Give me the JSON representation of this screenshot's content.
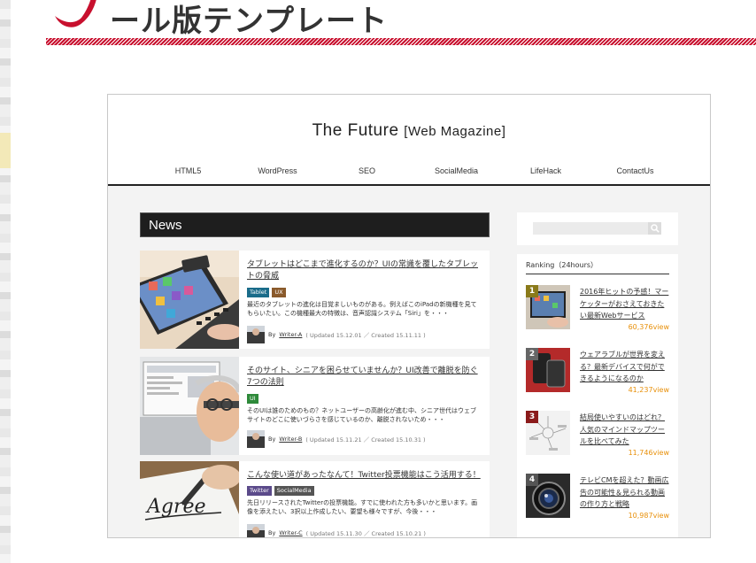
{
  "page": {
    "heading": "ール版テンプレート"
  },
  "site": {
    "title": "The Future",
    "subtitle": "[Web Magazine]",
    "nav": [
      "HTML5",
      "WordPress",
      "SEO",
      "SocialMedia",
      "LifeHack",
      "ContactUs"
    ]
  },
  "news": {
    "section_title": "News",
    "articles": [
      {
        "title": "タブレットはどこまで進化するのか？UIの常識を覆したタブレットの脅威",
        "tags": [
          {
            "label": "Tablet",
            "color": "#1a6c8a"
          },
          {
            "label": "UX",
            "color": "#8a5a2b"
          }
        ],
        "excerpt": "最近のタブレットの進化は目覚ましいものがある。例えばこのiPadの新機種を見てもらいたい。この機種最大の特徴は、音声認識システム「Siri」を・・・",
        "by": "By",
        "writer": "Writer-A",
        "dates": "( Updated 15.12.01 ／ Created 15.11.11 )"
      },
      {
        "title": "そのサイト、シニアを困らせていませんか？UI改善で離脱を防ぐ7つの法則",
        "tags": [
          {
            "label": "UI",
            "color": "#2e8a3a"
          }
        ],
        "excerpt": "そのUIは誰のためのもの？ネットユーザーの高齢化が進む中、シニア世代はウェブサイトのどこに使いづらさを感じているのか、離脱されないため・・・",
        "by": "By",
        "writer": "Writer-B",
        "dates": "( Updated 15.11.21 ／ Created 15.10.31 )"
      },
      {
        "title": "こんな使い道があったなんて！Twitter投票機能はこう活用する！",
        "tags": [
          {
            "label": "Twitter",
            "color": "#5b4a8a"
          },
          {
            "label": "SocialMedia",
            "color": "#555555"
          }
        ],
        "excerpt": "先日リリースされたTwitterの投票機能。すでに使われた方も多いかと思います。画像を添えたい、3択以上作成したい、要望も様々ですが、今後・・・",
        "by": "By",
        "writer": "Writer-C",
        "dates": "( Updated 15.11.30 ／ Created 15.10.21 )"
      }
    ]
  },
  "sidebar": {
    "search": {
      "placeholder": ""
    },
    "ranking_title": "Ranking（24hours）",
    "ranking": [
      {
        "num": "1",
        "num_color": "#8a7a1a",
        "title": "2016年ヒットの予感！マーケッターがおさえておきたい最新Webサービス",
        "views": "60,376view"
      },
      {
        "num": "2",
        "num_color": "#666666",
        "title": "ウェアラブルが世界を変える？最新デバイスで何ができるようになるのか",
        "views": "41,237view"
      },
      {
        "num": "3",
        "num_color": "#8a1a1a",
        "title": "結局使いやすいのはどれ？人気のマインドマップツールを比べてみた",
        "views": "11,746view"
      },
      {
        "num": "4",
        "num_color": "#555555",
        "title": "テレビCMを超えた？動画広告の可能性＆見られる動画の作り方と戦略",
        "views": "10,987view"
      }
    ]
  },
  "colors": {
    "accent_red": "#c8102e",
    "news_bar": "#1e1e1e",
    "views": "#e8900a"
  }
}
